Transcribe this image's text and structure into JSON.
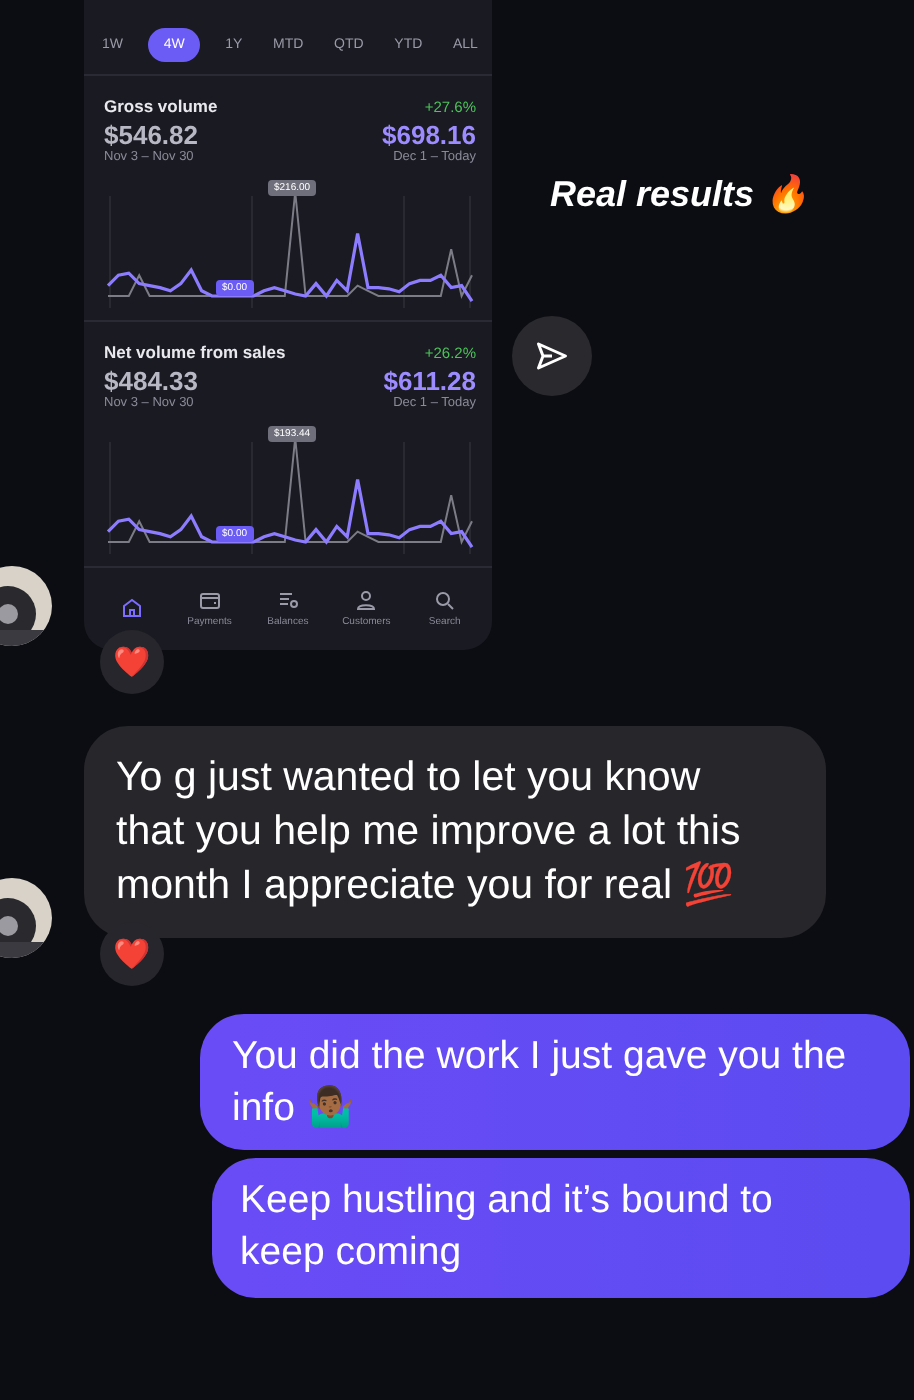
{
  "story_card": {
    "tabs": [
      {
        "label": "1W",
        "selected": false
      },
      {
        "label": "4W",
        "selected": true
      },
      {
        "label": "1Y",
        "selected": false
      },
      {
        "label": "MTD",
        "selected": false
      },
      {
        "label": "QTD",
        "selected": false
      },
      {
        "label": "YTD",
        "selected": false
      },
      {
        "label": "ALL",
        "selected": false
      }
    ],
    "metrics": [
      {
        "title": "Gross volume",
        "change": "+27.6%",
        "previous_value": "$546.82",
        "previous_range": "Nov 3 – Nov 30",
        "current_value": "$698.16",
        "current_range": "Dec 1 – Today",
        "peak_label": "$216.00",
        "zero_label": "$0.00"
      },
      {
        "title": "Net volume from sales",
        "change": "+26.2%",
        "previous_value": "$484.33",
        "previous_range": "Nov 3 – Nov 30",
        "current_value": "$611.28",
        "current_range": "Dec 1 – Today",
        "peak_label": "$193.44",
        "zero_label": "$0.00"
      }
    ],
    "nav": [
      {
        "kind": "home",
        "selected": true
      },
      {
        "kind": "wallet",
        "label": "Payments",
        "selected": false
      },
      {
        "kind": "balances",
        "label": "Balances",
        "selected": false
      },
      {
        "kind": "person",
        "label": "Customers",
        "selected": false
      },
      {
        "kind": "search",
        "label": "Search",
        "selected": false
      }
    ],
    "reaction": "❤️"
  },
  "caption": "Real results 🔥",
  "messages": [
    {
      "kind": "received",
      "text": "Yo g just wanted to let you know that you help me improve a lot this month I appreciate you for real 💯",
      "reaction": "❤️"
    },
    {
      "kind": "sent",
      "text": "You did the work I just gave you the info 🤷🏾‍♂️"
    },
    {
      "kind": "sent",
      "text": "Keep hustling and it’s bound to keep coming"
    }
  ]
}
